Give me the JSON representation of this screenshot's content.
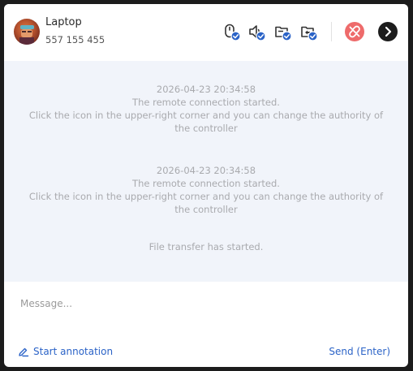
{
  "header": {
    "title": "Laptop",
    "subtitle": "557 155 455",
    "icons": [
      "permission-mouse-icon",
      "permission-sound-icon",
      "permission-clipboard-icon",
      "permission-file-icon",
      "disconnect-icon",
      "next-icon"
    ]
  },
  "log": {
    "entries": [
      {
        "timestamp": "2026-04-23 20:34:58",
        "line1": "The remote connection started.",
        "line2": "Click the icon in the upper-right corner and you can change the authority of",
        "line3": "the controller"
      },
      {
        "timestamp": "2026-04-23 20:34:58",
        "line1": "The remote connection started.",
        "line2": "Click the icon in the upper-right corner and you can change the authority of",
        "line3": "the controller"
      }
    ],
    "file_transfer": "File transfer has started."
  },
  "composer": {
    "placeholder": "Message...",
    "annotation_label": "Start annotation",
    "send_label": "Send (Enter)"
  },
  "colors": {
    "accent": "#2b63c7",
    "check_badge": "#2b63c7",
    "disconnect": "#ee6b6b",
    "log_bg": "#f1f4fa",
    "log_text": "#a9aaae"
  }
}
